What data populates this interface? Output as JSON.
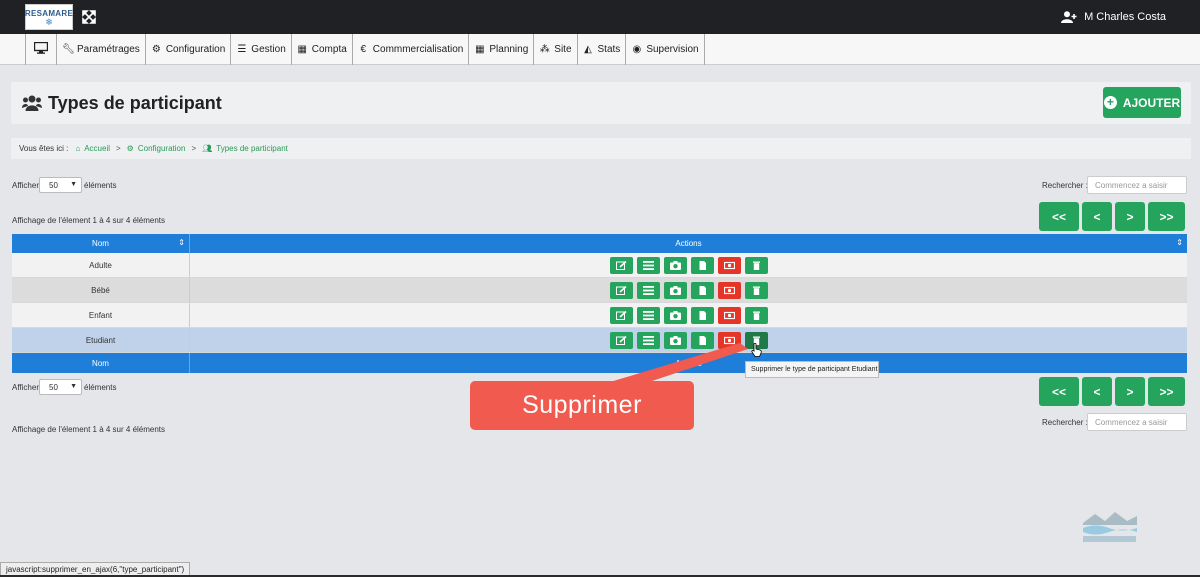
{
  "header": {
    "logo_text": "RESAMARE",
    "user_name": "M Charles Costa"
  },
  "menu": {
    "items": [
      {
        "label": "",
        "icon": "monitor-icon"
      },
      {
        "label": "Paramétrages",
        "icon": "wrench-icon"
      },
      {
        "label": "Configuration",
        "icon": "gears-icon"
      },
      {
        "label": "Gestion",
        "icon": "list-icon"
      },
      {
        "label": "Compta",
        "icon": "calculator-icon"
      },
      {
        "label": "Commmercialisation",
        "icon": "euro-icon"
      },
      {
        "label": "Planning",
        "icon": "calendar-icon"
      },
      {
        "label": "Site",
        "icon": "sitemap-icon"
      },
      {
        "label": "Stats",
        "icon": "chart-icon"
      },
      {
        "label": "Supervision",
        "icon": "eye-icon"
      }
    ]
  },
  "page": {
    "title": "Types de participant",
    "add_label": "AJOUTER"
  },
  "breadcrumb": {
    "prefix": "Vous êtes ici :",
    "items": [
      "Accueil",
      "Configuration",
      "Types de participant"
    ],
    "separator": ">"
  },
  "controls": {
    "show_label": "Afficher",
    "page_size": "50",
    "elements_label": "éléments",
    "search_label": "Rechercher :",
    "search_placeholder": "Commencez a saisir",
    "info": "Affichage de l'élement 1 à 4 sur 4 éléments",
    "pager": [
      "<<",
      "<",
      ">",
      ">>"
    ]
  },
  "table": {
    "columns": [
      "Nom",
      "Actions"
    ],
    "rows": [
      "Adulte",
      "Bébé",
      "Enfant",
      "Etudiant"
    ]
  },
  "tooltip": "Supprimer le type de participant Etudiant",
  "callout": "Supprimer",
  "status_bar": "javascript:supprimer_en_ajax(6,\"type_participant\")",
  "colors": {
    "green": "#24a45c",
    "red": "#e53527",
    "blue": "#1f7fd8",
    "topbar": "#1f2125",
    "callout": "#f05a4f"
  }
}
